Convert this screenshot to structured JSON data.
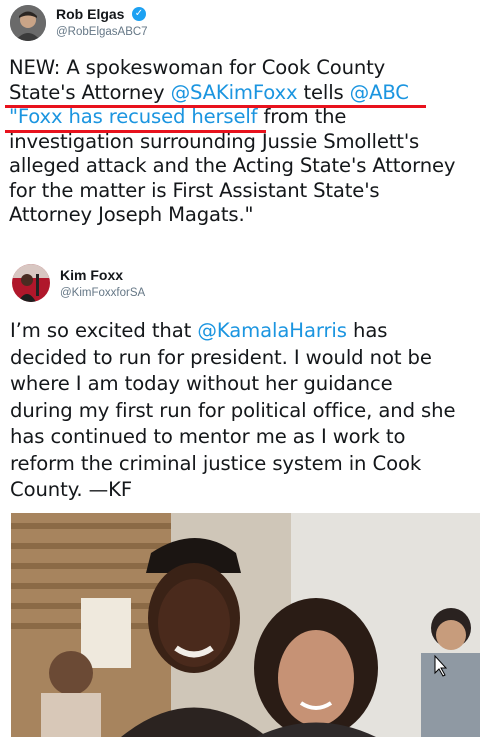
{
  "tweet1": {
    "name": "Rob Elgas",
    "handle": "@RobElgasABC7",
    "verified": true,
    "line1": "NEW: A spokeswoman for Cook County",
    "l2_pre": "State's Attorney ",
    "mention_sakim": "@SAKimFoxx",
    "l2_mid": " tells ",
    "mention_abc": "@ABC",
    "l3_quote": "\"Foxx has recused herself",
    "l3_rest": " from the",
    "line4": "investigation surrounding Jussie Smollett's",
    "line5": "alleged attack and the Acting State's Attorney",
    "line6": "for the matter is First Assistant State's",
    "line7": "Attorney Joseph Magats.\""
  },
  "tweet2": {
    "name": "Kim Foxx",
    "handle": "@KimFoxxforSA",
    "l1_pre": "I’m so excited that ",
    "mention_kamala": "@KamalaHarris",
    "l1_post": " has",
    "line2": "decided to run for president. I would not be",
    "line3": "where I am today without her guidance",
    "line4": "during my first run for political office, and she",
    "line5": "has continued to mentor me as I work to",
    "line6": "reform the criminal justice system in Cook",
    "line7": "County.  —KF"
  },
  "colors": {
    "mention": "#1b95e0",
    "highlight_underline": "#e8121d",
    "verified": "#1da1f2"
  },
  "icons": {
    "verified": "verified-badge-icon"
  }
}
